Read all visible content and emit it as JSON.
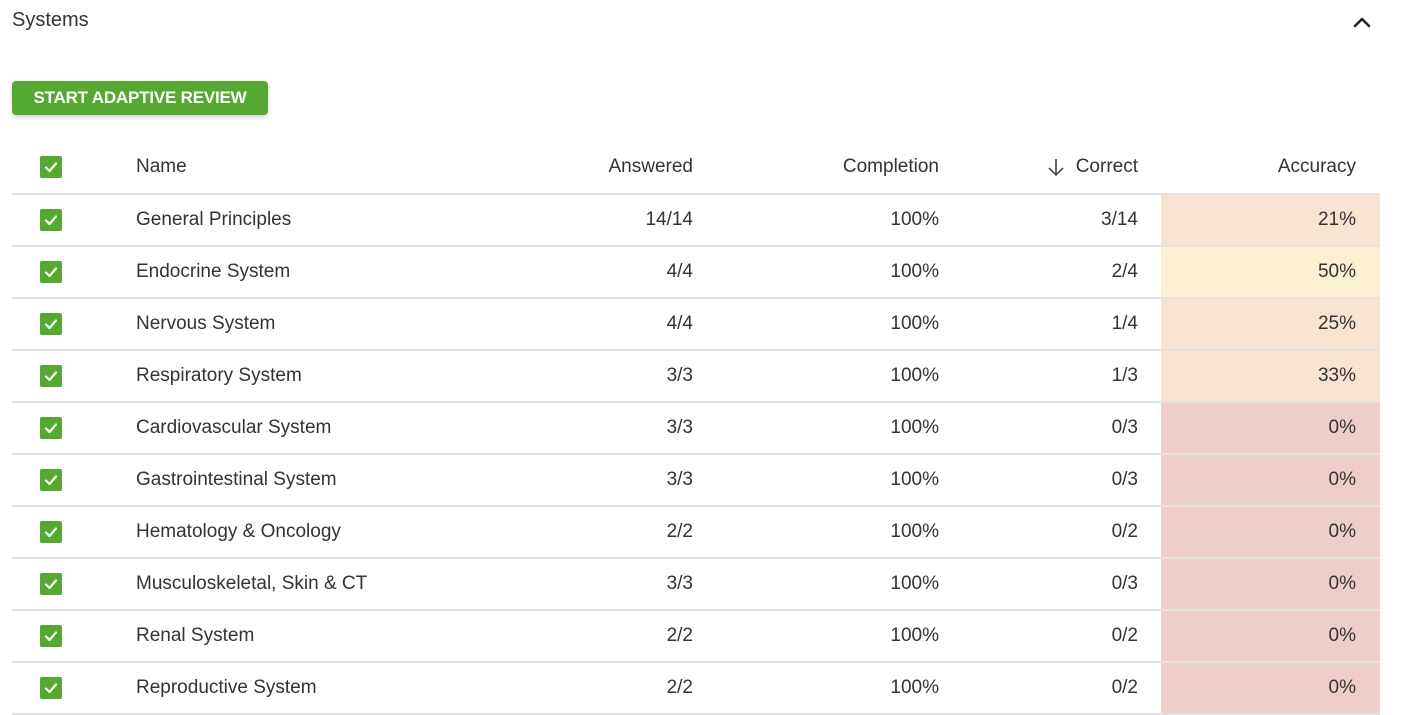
{
  "section": {
    "title": "Systems",
    "collapse_icon": "chevron-up-icon"
  },
  "actions": {
    "start_label": "START ADAPTIVE REVIEW",
    "brand_color": "#55a933"
  },
  "table": {
    "columns": {
      "name": "Name",
      "answered": "Answered",
      "completion": "Completion",
      "correct": "Correct",
      "accuracy": "Accuracy"
    },
    "sort": {
      "column": "correct",
      "direction": "descending",
      "icon": "arrow-down-icon"
    },
    "select_all_checked": true,
    "rows": [
      {
        "checked": true,
        "name": "General Principles",
        "answered": "14/14",
        "completion": "100%",
        "correct": "3/14",
        "accuracy": "21%",
        "accuracy_color": "#f7e4d0"
      },
      {
        "checked": true,
        "name": "Endocrine System",
        "answered": "4/4",
        "completion": "100%",
        "correct": "2/4",
        "accuracy": "50%",
        "accuracy_color": "#fcf0d0"
      },
      {
        "checked": true,
        "name": "Nervous System",
        "answered": "4/4",
        "completion": "100%",
        "correct": "1/4",
        "accuracy": "25%",
        "accuracy_color": "#f7e4d0"
      },
      {
        "checked": true,
        "name": "Respiratory System",
        "answered": "3/3",
        "completion": "100%",
        "correct": "1/3",
        "accuracy": "33%",
        "accuracy_color": "#f7e4d0"
      },
      {
        "checked": true,
        "name": "Cardiovascular System",
        "answered": "3/3",
        "completion": "100%",
        "correct": "0/3",
        "accuracy": "0%",
        "accuracy_color": "#eecdcb"
      },
      {
        "checked": true,
        "name": "Gastrointestinal System",
        "answered": "3/3",
        "completion": "100%",
        "correct": "0/3",
        "accuracy": "0%",
        "accuracy_color": "#eecdcb"
      },
      {
        "checked": true,
        "name": "Hematology & Oncology",
        "answered": "2/2",
        "completion": "100%",
        "correct": "0/2",
        "accuracy": "0%",
        "accuracy_color": "#eecdcb"
      },
      {
        "checked": true,
        "name": "Musculoskeletal, Skin & CT",
        "answered": "3/3",
        "completion": "100%",
        "correct": "0/3",
        "accuracy": "0%",
        "accuracy_color": "#eecdcb"
      },
      {
        "checked": true,
        "name": "Renal System",
        "answered": "2/2",
        "completion": "100%",
        "correct": "0/2",
        "accuracy": "0%",
        "accuracy_color": "#eecdcb"
      },
      {
        "checked": true,
        "name": "Reproductive System",
        "answered": "2/2",
        "completion": "100%",
        "correct": "0/2",
        "accuracy": "0%",
        "accuracy_color": "#eecdcb"
      }
    ]
  }
}
